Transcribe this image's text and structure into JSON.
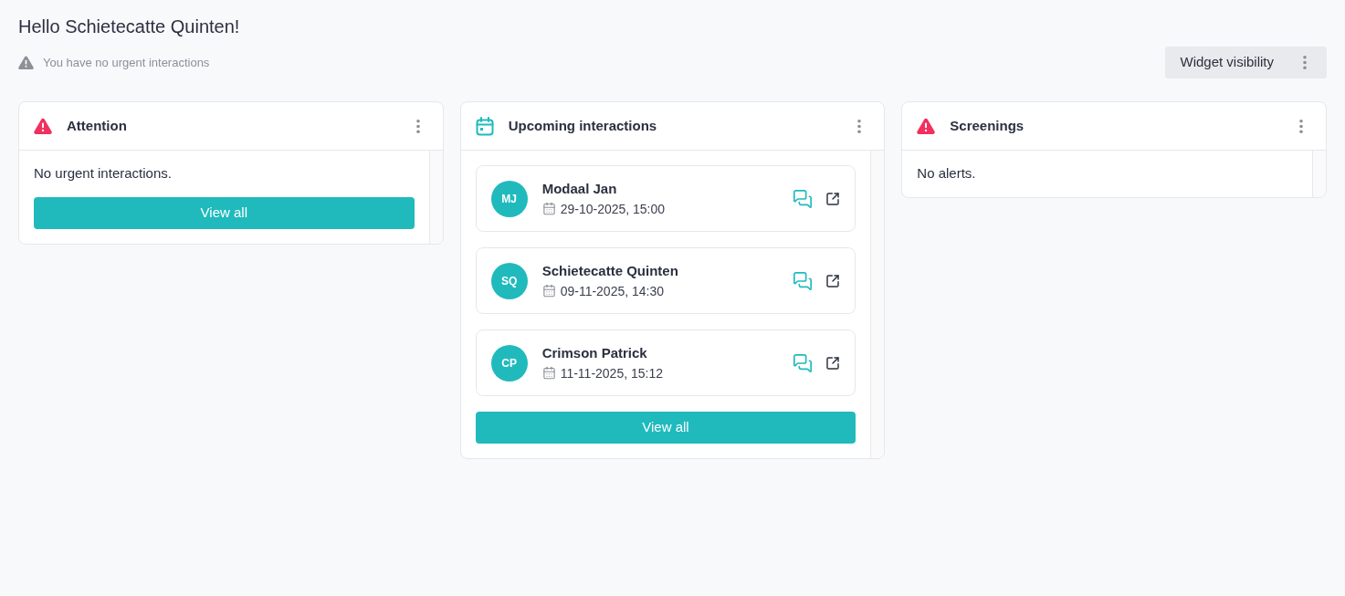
{
  "greeting": {
    "title": "Hello Schietecatte Quinten!",
    "notice": "You have no urgent interactions"
  },
  "toolbar": {
    "button": "Widget visibility"
  },
  "widgets": [
    {
      "kind": "message",
      "title": "Attention",
      "message": "No urgent interactions.",
      "button": "View all"
    },
    {
      "kind": "list",
      "title": "Upcoming interactions",
      "items": [
        {
          "initials": "MJ",
          "name": "Modaal Jan",
          "datetime": "29-10-2025, 15:00"
        },
        {
          "initials": "SQ",
          "name": "Schietecatte Quinten",
          "datetime": "09-11-2025, 14:30"
        },
        {
          "initials": "CP",
          "name": "Crimson Patrick",
          "datetime": "11-11-2025, 15:12"
        }
      ],
      "button": "View all"
    },
    {
      "kind": "message",
      "title": "Screenings",
      "message": "No alerts."
    }
  ]
}
